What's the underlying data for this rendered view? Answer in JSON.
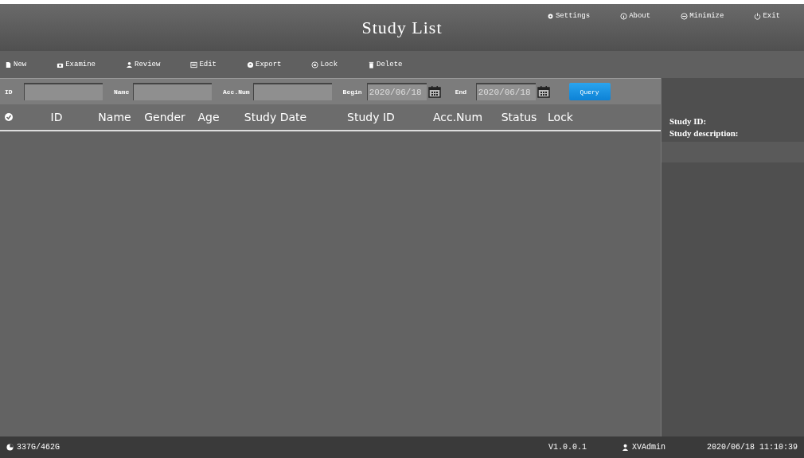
{
  "window": {
    "title": "Study List"
  },
  "header_buttons": [
    {
      "kind": "settings",
      "label": "Settings"
    },
    {
      "kind": "about",
      "label": "About"
    },
    {
      "kind": "minimize",
      "label": "Minimize"
    },
    {
      "kind": "exit",
      "label": "Exit"
    }
  ],
  "toolbar": [
    {
      "kind": "new",
      "label": "New"
    },
    {
      "kind": "examine",
      "label": "Examine"
    },
    {
      "kind": "review",
      "label": "Review"
    },
    {
      "kind": "edit",
      "label": "Edit"
    },
    {
      "kind": "export",
      "label": "Export"
    },
    {
      "kind": "lock",
      "label": "Lock"
    },
    {
      "kind": "delete",
      "label": "Delete"
    }
  ],
  "filters": [
    {
      "kind": "text",
      "label": "ID"
    },
    {
      "kind": "text",
      "label": "Name"
    },
    {
      "kind": "text",
      "label": "Acc.Num"
    },
    {
      "kind": "date",
      "label": "Begin",
      "value": "2020/06/18"
    },
    {
      "kind": "date",
      "label": "End",
      "value": "2020/06/18"
    }
  ],
  "query_button": "Query",
  "table": {
    "columns": [
      "ID",
      "Name",
      "Gender",
      "Age",
      "Study Date",
      "Study ID",
      "Acc.Num",
      "Status",
      "Lock"
    ]
  },
  "details": {
    "study_id_label": "Study ID:",
    "description_label": "Study description:"
  },
  "status_bar": {
    "disk": "337G/462G",
    "version": "V1.0.0.1",
    "user": "XVAdmin",
    "datetime": "2020/06/18 11:10:39"
  }
}
